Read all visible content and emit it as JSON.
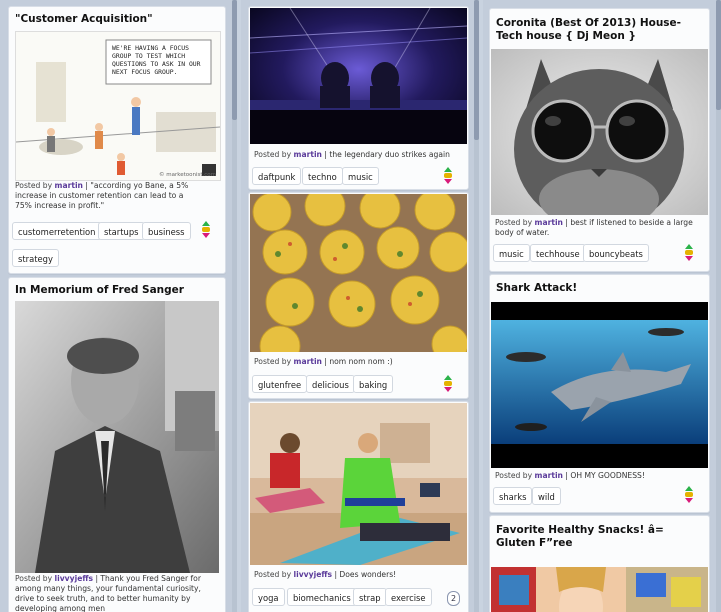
{
  "columns": {
    "left": {
      "cards": [
        {
          "title": "\"Customer Acquisition\"",
          "cartoon_text": "WE'RE HAVING A FOCUS GROUP TO TEST WHICH QUESTIONS TO ASK IN OUR NEXT FOCUS GROUP.",
          "watermark": "© marketoonist.com",
          "caption_prefix": "Posted by",
          "user": "martin",
          "caption": "| \"according yo Bane, a 5% increase in customer retention can lead to a 75% increase in profit.\"",
          "tags": [
            "customerretention",
            "startups",
            "business",
            "strategy"
          ]
        },
        {
          "title": "In Memorium of Fred Sanger",
          "caption_prefix": "Posted by",
          "user": "livvyjeffs",
          "caption": "| Thank you Fred Sanger for among many things, your fundamental curiosity, drive to seek truth, and to better humanity by developing among men"
        }
      ]
    },
    "middle": {
      "cards": [
        {
          "caption_prefix": "Posted by",
          "user": "martin",
          "caption": "| the legendary duo strikes again",
          "tags": [
            "daftpunk",
            "techno",
            "music"
          ]
        },
        {
          "caption_prefix": "Posted by",
          "user": "martin",
          "caption": "| nom nom nom :)",
          "tags": [
            "glutenfree",
            "delicious",
            "baking"
          ]
        },
        {
          "caption_prefix": "Posted by",
          "user": "livvyjeffs",
          "caption": "| Does wonders!",
          "tags": [
            "yoga",
            "biomechanics",
            "strap",
            "exercise"
          ],
          "comment_count": "2"
        }
      ]
    },
    "right": {
      "cards": [
        {
          "title": "Coronita (Best Of 2013) House-Tech house { Dj Meon }",
          "caption_prefix": "Posted by",
          "user": "martin",
          "caption": "| best if listened to beside a large body of water.",
          "tags": [
            "music",
            "techhouse",
            "bouncybeats"
          ]
        },
        {
          "title": "Shark Attack!",
          "caption_prefix": "Posted by",
          "user": "martin",
          "caption": "| OH MY GOODNESS!",
          "tags": [
            "sharks",
            "wild"
          ]
        },
        {
          "title": "Favorite Healthy Snacks! â= Gluten F”ree"
        }
      ]
    }
  },
  "colors": {
    "background": "#c9d3e0",
    "card": "#fbfcfd",
    "username": "#5a3a9a",
    "vote_up": "#2bb34a",
    "vote_down": "#d81b7a"
  }
}
